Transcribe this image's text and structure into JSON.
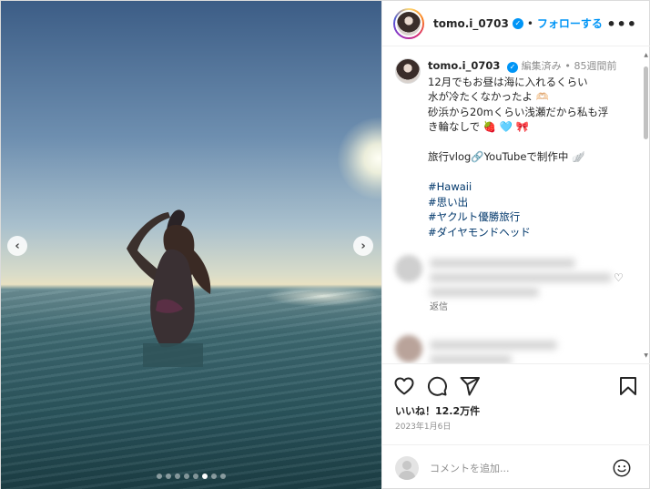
{
  "header": {
    "username": "tomo.i_0703",
    "separator": "•",
    "follow_label": "フォローする",
    "more_label": "•••"
  },
  "caption": {
    "username": "tomo.i_0703",
    "edited": "編集済み",
    "dot": "•",
    "time_ago": "85週間前",
    "lines": [
      "12月でもお昼は海に入れるくらい",
      "水が冷たくなかったよ 🫶🏻",
      "砂浜から20mくらい浅瀬だから私も浮",
      "き輪なしで 🍓 🩵 🎀"
    ],
    "line5": "旅行vlog🔗YouTubeで制作中 🪽",
    "hashtags": [
      "#Hawaii",
      "#思い出",
      "#ヤクルト優勝旅行",
      "#ダイヤモンドヘッド"
    ]
  },
  "comments": {
    "reply_label": "返信"
  },
  "actions": {
    "likes": "いいね！12.2万件",
    "date": "2023年1月6日"
  },
  "add_comment": {
    "placeholder": "コメントを追加..."
  },
  "carousel": {
    "prev_label": "‹",
    "next_label": "›",
    "dot_count": 8,
    "active_index": 5
  },
  "colors": {
    "accent": "#0095f6",
    "hashtag": "#00376b",
    "meta": "#8e8e8e"
  },
  "icons": [
    "verified-icon",
    "more-icon",
    "heart-icon",
    "comment-icon",
    "share-icon",
    "bookmark-icon",
    "emoji-icon",
    "chevron-left-icon",
    "chevron-right-icon"
  ]
}
